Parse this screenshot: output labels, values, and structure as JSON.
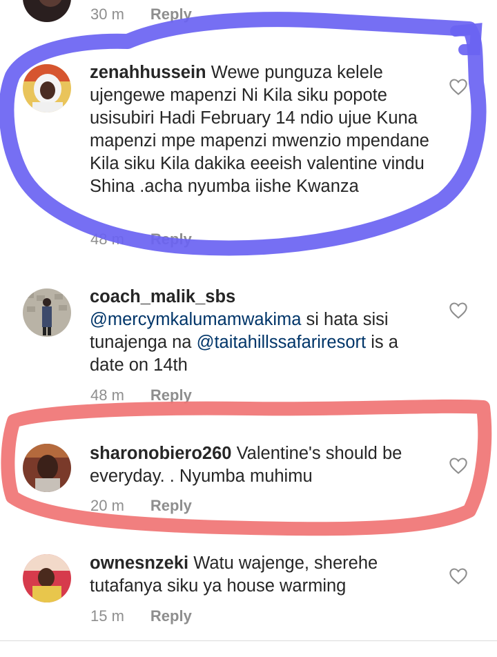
{
  "top_meta": {
    "time": "30 m",
    "reply": "Reply"
  },
  "comments": [
    {
      "username": "zenahhussein",
      "text": " Wewe punguza kelele ujengewe mapenzi Ni Kila siku popote usisubiri Hadi February 14 ndio ujue Kuna mapenzi mpe mapenzi mwenzio mpendane Kila siku Kila dakika  eeeish valentine vindu Shina .acha nyumba iishe Kwanza",
      "time": "48 m",
      "reply": "Reply"
    },
    {
      "username": "coach_malik_sbs",
      "mention1": "@mercymkalumamwakima",
      "text1": " si hata sisi tunajenga na ",
      "mention2": "@taitahillssafariresort",
      "text2": " is a date on 14th",
      "time": "48 m",
      "reply": "Reply"
    },
    {
      "username": "sharonobiero260",
      "text": " Valentine's should be everyday. . Nyumba muhimu",
      "time": "20 m",
      "reply": "Reply"
    },
    {
      "username": "ownesnzeki",
      "text": " Watu wajenge, sherehe tutafanya siku ya house warming",
      "time": "15 m",
      "reply": "Reply"
    }
  ],
  "colors": {
    "highlight_blue": "#6a63f2",
    "highlight_red": "#f07474",
    "mention": "#003569"
  },
  "icons": [
    "heart-outline-icon"
  ]
}
